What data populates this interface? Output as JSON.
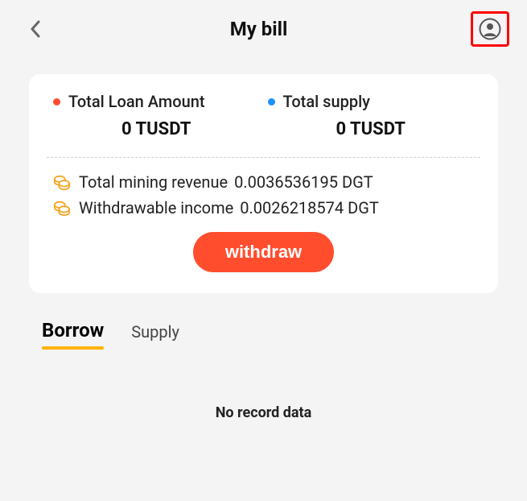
{
  "header": {
    "title": "My bill"
  },
  "card": {
    "loan": {
      "label": "Total Loan Amount",
      "value": "0 TUSDT"
    },
    "supply": {
      "label": "Total supply",
      "value": "0 TUSDT"
    },
    "mining": {
      "label": "Total mining revenue",
      "value": "0.0036536195 DGT"
    },
    "withdrawable": {
      "label": "Withdrawable income",
      "value": "0.0026218574 DGT"
    },
    "withdraw_btn": "withdraw"
  },
  "tabs": {
    "borrow": "Borrow",
    "supply": "Supply"
  },
  "empty": "No record data",
  "colors": {
    "accent": "#ff4d2e",
    "tab_underline": "#ffb300"
  }
}
